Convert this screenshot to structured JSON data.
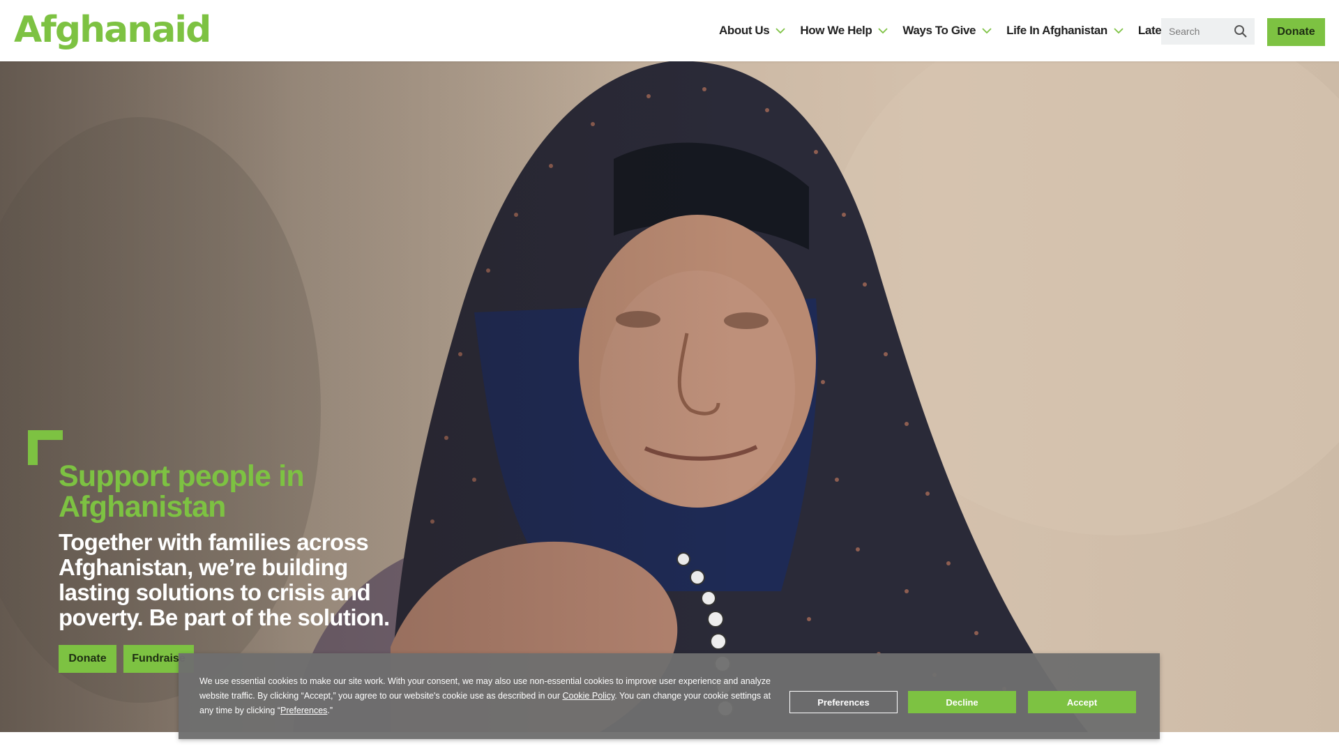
{
  "header": {
    "logo_text": "Afghanaid",
    "nav": [
      {
        "label": "About Us"
      },
      {
        "label": "How We Help"
      },
      {
        "label": "Ways To Give"
      },
      {
        "label": "Life In Afghanistan"
      },
      {
        "label": "Latest"
      }
    ],
    "search_placeholder": "Search",
    "donate_label": "Donate"
  },
  "hero": {
    "title": "Support people in Afghanistan",
    "subtitle": "Together with families across Afghanistan, we’re building lasting solutions to crisis and poverty. Be part of the solution.",
    "donate_label": "Donate",
    "fundraise_label": "Fundraise"
  },
  "cookie_banner": {
    "text_before_link": "We use essential cookies to make our site work. With your consent, we may also use non-essential cookies to improve user experience and analyze website traffic. By clicking “Accept,” you agree to our website's cookie use as described in our ",
    "cookie_policy_link": "Cookie Policy",
    "text_middle": ". You can change your cookie settings at any time by clicking “",
    "preferences_link": "Preferences",
    "text_end": ".”",
    "preferences_button": "Preferences",
    "decline_button": "Decline",
    "accept_button": "Accept"
  },
  "colors": {
    "brand_green": "#7dc242",
    "cookie_bg": "#6e6e6e",
    "nav_text": "#222222"
  },
  "icons": [
    "chevron-down-icon",
    "search-icon",
    "corner-bracket-icon"
  ]
}
